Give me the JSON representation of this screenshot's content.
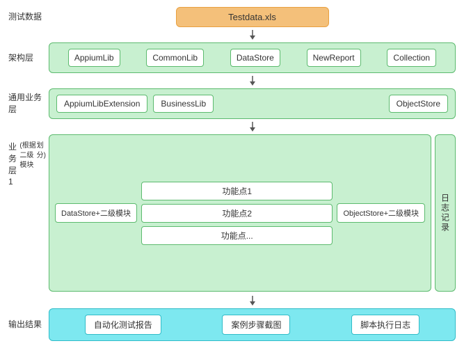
{
  "layers": {
    "testdata": {
      "label": "测试数据",
      "box": "Testdata.xls"
    },
    "arch": {
      "label": "架构层",
      "boxes": [
        "AppiumLib",
        "CommonLib",
        "DataStore",
        "NewReport",
        "Collection"
      ]
    },
    "common": {
      "label": "通用业务层",
      "boxes": [
        "AppiumLibExtension",
        "BusinessLib",
        "ObjectStore"
      ]
    },
    "biz1": {
      "label": "业务层1\n(根据二级模块\n划分)",
      "label_lines": [
        "业务层1",
        "(根据二级模块",
        "划分)"
      ],
      "datastore_box": "DataStore+二级模块",
      "feature_boxes": [
        "功能点1",
        "功能点2",
        "功能点..."
      ],
      "objectstore_box": "ObjectStore+二级模块",
      "log_label": "日\n志\n记\n录"
    },
    "output": {
      "label": "输出结果",
      "boxes": [
        "自动化测试报告",
        "案例步骤截图",
        "脚本执行日志"
      ]
    }
  }
}
